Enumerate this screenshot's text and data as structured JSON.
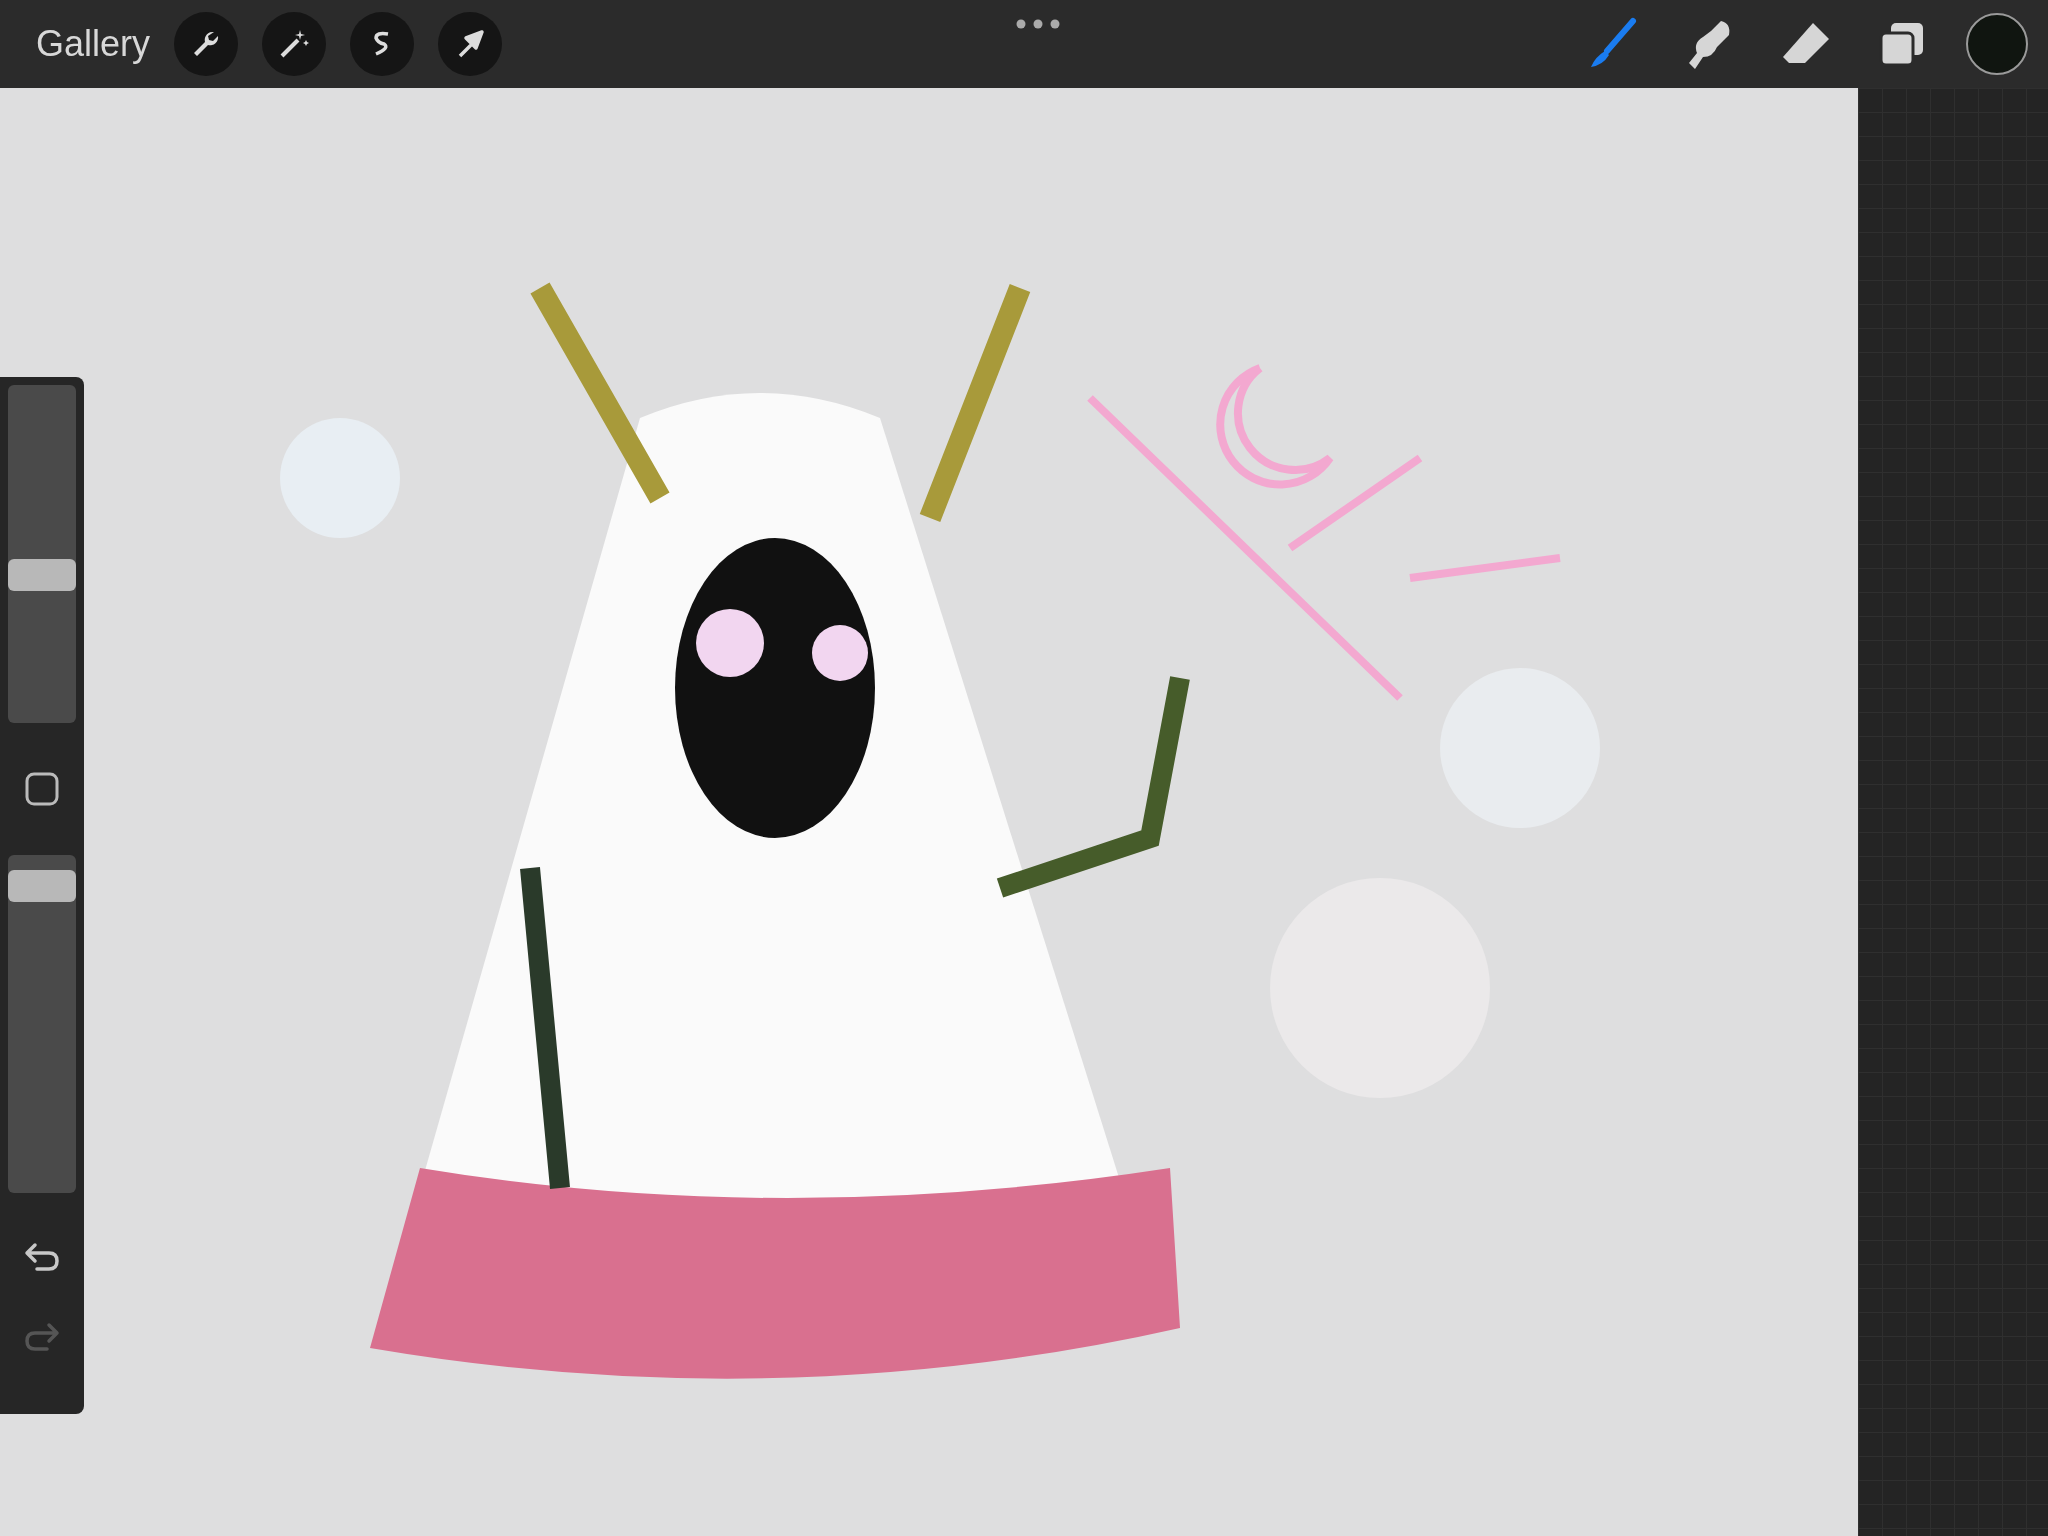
{
  "top_bar": {
    "gallery_label": "Gallery",
    "actions": [
      {
        "kind": "wrench"
      },
      {
        "kind": "wand"
      },
      {
        "kind": "selection"
      },
      {
        "kind": "transform"
      }
    ],
    "tools": [
      {
        "kind": "brush",
        "selected": true
      },
      {
        "kind": "smudge",
        "selected": false
      },
      {
        "kind": "eraser",
        "selected": false
      },
      {
        "kind": "layers",
        "selected": false
      }
    ],
    "color": "#101510"
  },
  "sidebar": {
    "brush_size": {
      "level": 0.43
    },
    "opacity": {
      "level": 0.95
    },
    "undo": {
      "disabled": false
    },
    "redo": {
      "disabled": true
    }
  }
}
